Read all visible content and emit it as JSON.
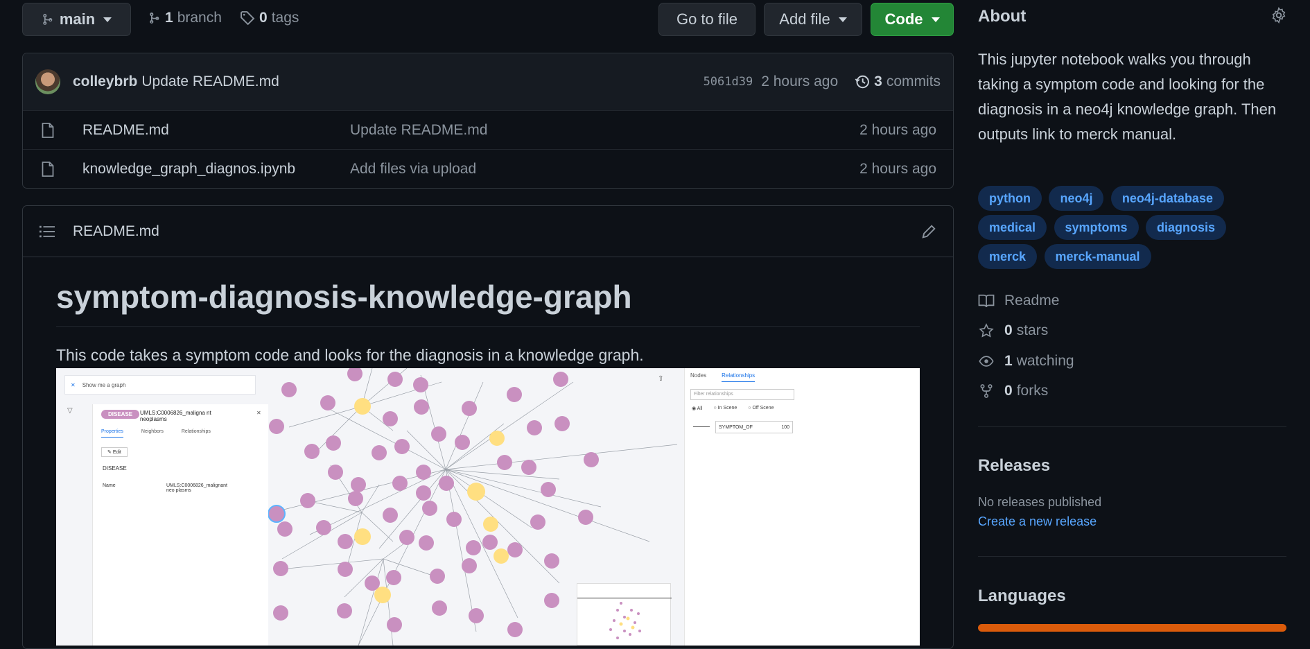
{
  "repo_bar": {
    "branch": "main",
    "branch_count": "1",
    "branch_label": "branch",
    "tag_count": "0",
    "tag_label": "tags",
    "go_to_file": "Go to file",
    "add_file": "Add file",
    "code": "Code"
  },
  "commit_bar": {
    "author": "colleybrb",
    "message": "Update README.md",
    "sha": "5061d39",
    "time": "2 hours ago",
    "commit_count": "3",
    "commit_label": "commits"
  },
  "files": [
    {
      "name": "README.md",
      "message": "Update README.md",
      "time": "2 hours ago"
    },
    {
      "name": "knowledge_graph_diagnos.ipynb",
      "message": "Add files via upload",
      "time": "2 hours ago"
    }
  ],
  "readme": {
    "header": "README.md",
    "title": "symptom-diagnosis-knowledge-graph",
    "description": "This code takes a symptom code and looks for the diagnosis in a knowledge graph."
  },
  "screenshot": {
    "search": "Show me a graph",
    "label": "DISEASE",
    "node_title": "UMLS:C0006826_maligna nt neoplasms",
    "tabs": [
      "Properties",
      "Neighbors",
      "Relationships"
    ],
    "edit": "Edit",
    "prop_label": "DISEASE",
    "name_key": "Name",
    "name_value": "UMLS:C0006826_malignant neo plasms",
    "right_tabs": [
      "Nodes",
      "Relationships"
    ],
    "filter": "Filter relationships",
    "radios": [
      "All",
      "In Scene",
      "Off Scene"
    ],
    "rel_name": "SYMPTOM_OF",
    "rel_count": "100"
  },
  "about": {
    "heading": "About",
    "description": "This jupyter notebook walks you through taking a symptom code and looking for the diagnosis in a neo4j knowledge graph. Then outputs link to merck manual.",
    "topics": [
      "python",
      "neo4j",
      "neo4j-database",
      "medical",
      "symptoms",
      "diagnosis",
      "merck",
      "merck-manual"
    ],
    "readme": "Readme",
    "stars_count": "0",
    "stars_label": "stars",
    "watching_count": "1",
    "watching_label": "watching",
    "forks_count": "0",
    "forks_label": "forks"
  },
  "releases": {
    "heading": "Releases",
    "none": "No releases published",
    "create": "Create a new release"
  },
  "languages": {
    "heading": "Languages",
    "bar_color": "#DA5B0B"
  },
  "colors": {
    "bg": "#0d1117",
    "accent": "#238636",
    "link": "#58a6ff"
  }
}
